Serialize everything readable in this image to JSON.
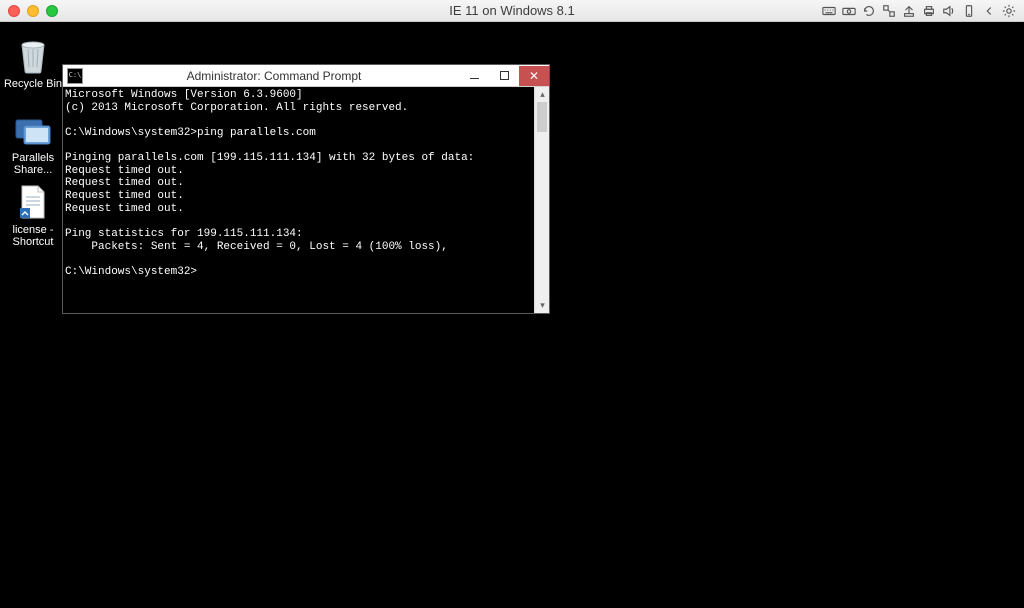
{
  "mac": {
    "title": "IE 11 on Windows 8.1"
  },
  "desktop": {
    "recycle_label": "Recycle Bin",
    "share_label": "Parallels Share...",
    "license_label": "license - Shortcut"
  },
  "cmd": {
    "caption": "Administrator: Command Prompt",
    "lines": {
      "l0": "Microsoft Windows [Version 6.3.9600]",
      "l1": "(c) 2013 Microsoft Corporation. All rights reserved.",
      "l2": "",
      "l3": "C:\\Windows\\system32>ping parallels.com",
      "l4": "",
      "l5": "Pinging parallels.com [199.115.111.134] with 32 bytes of data:",
      "l6": "Request timed out.",
      "l7": "Request timed out.",
      "l8": "Request timed out.",
      "l9": "Request timed out.",
      "l10": "",
      "l11": "Ping statistics for 199.115.111.134:",
      "l12": "    Packets: Sent = 4, Received = 0, Lost = 4 (100% loss),",
      "l13": "",
      "l14": "C:\\Windows\\system32>"
    }
  }
}
